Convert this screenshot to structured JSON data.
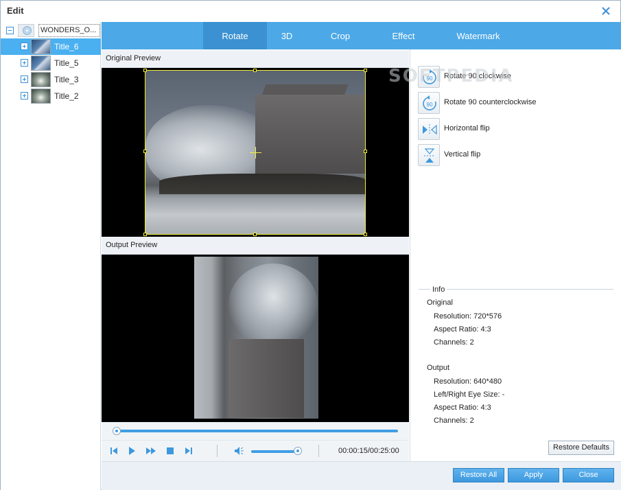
{
  "window": {
    "title": "Edit"
  },
  "tree": {
    "root_label": "WONDERS_O...",
    "items": [
      {
        "label": "Title_6",
        "selected": true,
        "thumb": "wave"
      },
      {
        "label": "Title_5",
        "selected": false,
        "thumb": "wave"
      },
      {
        "label": "Title_3",
        "selected": false,
        "thumb": "drop"
      },
      {
        "label": "Title_2",
        "selected": false,
        "thumb": "drop"
      }
    ]
  },
  "tabs": [
    {
      "label": "Rotate",
      "active": true
    },
    {
      "label": "3D",
      "active": false
    },
    {
      "label": "Crop",
      "active": false
    },
    {
      "label": "Effect",
      "active": false
    },
    {
      "label": "Watermark",
      "active": false
    }
  ],
  "preview": {
    "original_label": "Original Preview",
    "output_label": "Output Preview"
  },
  "rotate_actions": [
    {
      "label": "Rotate 90 clockwise",
      "icon": "rotate-clockwise-icon"
    },
    {
      "label": "Rotate 90 counterclockwise",
      "icon": "rotate-counterclockwise-icon"
    },
    {
      "label": "Horizontal flip",
      "icon": "horizontal-flip-icon"
    },
    {
      "label": "Vertical flip",
      "icon": "vertical-flip-icon"
    }
  ],
  "rotate_icon_text": "90",
  "watermark_overlay": "SOFTPEDIA",
  "info": {
    "title": "Info",
    "original": {
      "heading": "Original",
      "resolution": "Resolution: 720*576",
      "aspect": "Aspect Ratio: 4:3",
      "channels": "Channels: 2"
    },
    "output": {
      "heading": "Output",
      "resolution": "Resolution: 640*480",
      "eye_size": "Left/Right Eye Size: -",
      "aspect": "Aspect Ratio: 4:3",
      "channels": "Channels: 2"
    }
  },
  "player": {
    "timecode": "00:00:15/00:25:00",
    "seek_progress": 0.0,
    "volume_level": 0.9
  },
  "buttons": {
    "restore_defaults": "Restore Defaults",
    "restore_all": "Restore All",
    "apply": "Apply",
    "close": "Close"
  },
  "colors": {
    "accent": "#4ca8e6",
    "active_tab": "#3b91d1",
    "selection": "#4ab0f0",
    "crop_frame": "#f2ef3a"
  }
}
